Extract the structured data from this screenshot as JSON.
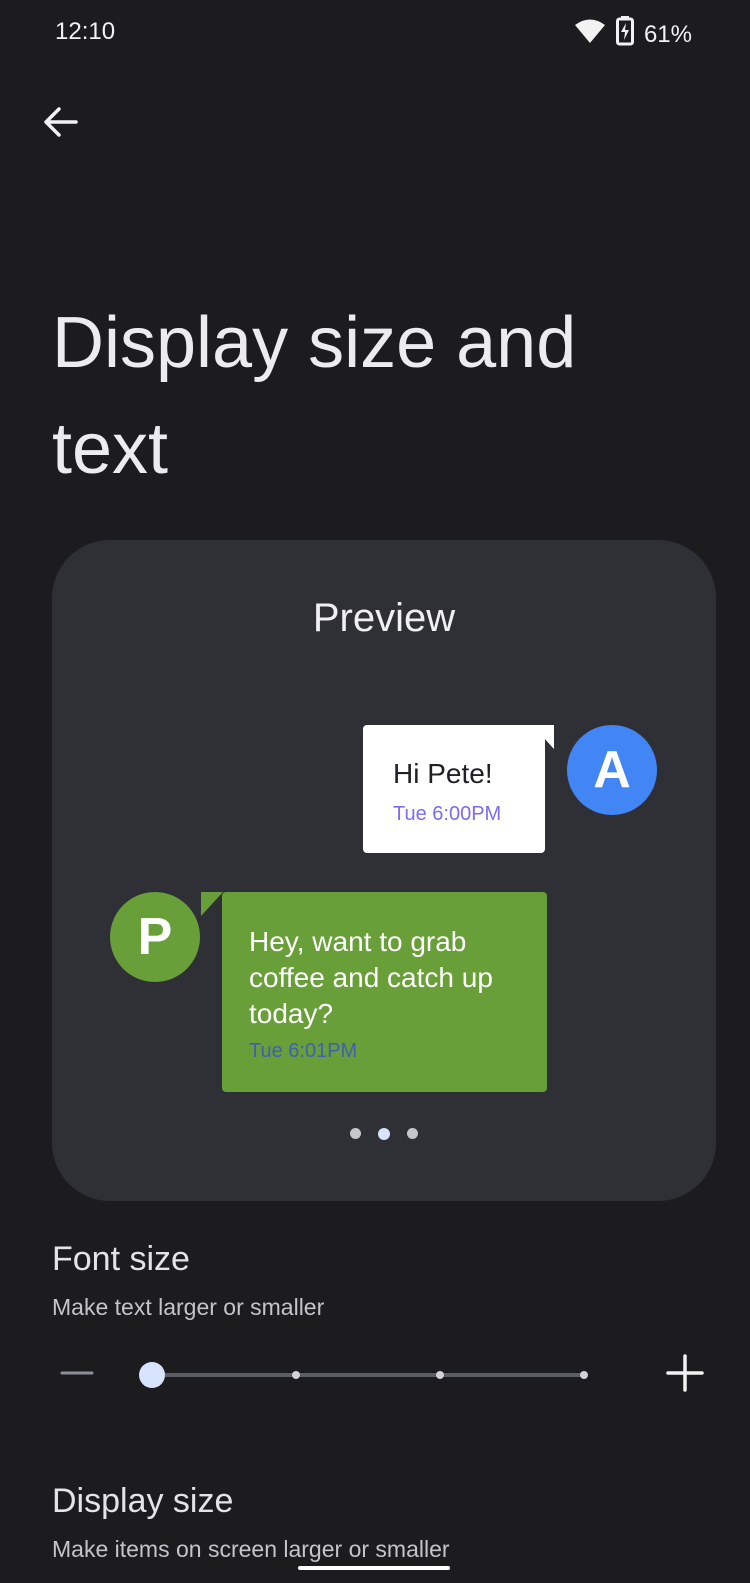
{
  "status_bar": {
    "time": "12:10",
    "battery": "61%",
    "icons": [
      "wifi-icon",
      "battery-charging-icon"
    ]
  },
  "header": {
    "back_icon": "arrow-back-icon"
  },
  "title": "Display size and text",
  "preview": {
    "title": "Preview",
    "outgoing": {
      "avatar_letter": "A",
      "message": "Hi Pete!",
      "time": "Tue 6:00PM",
      "avatar_color": "#4285f4"
    },
    "incoming": {
      "avatar_letter": "P",
      "message": "Hey, want to grab coffee and catch up today?",
      "time": "Tue 6:01PM",
      "bubble_color": "#689f38"
    },
    "pages": 3,
    "current_page": 2
  },
  "font_size": {
    "title": "Font size",
    "subtitle": "Make text larger or smaller",
    "steps": 4,
    "current_step": 1,
    "decrease_icon": "minus-icon",
    "increase_icon": "plus-icon"
  },
  "display_size": {
    "title": "Display size",
    "subtitle": "Make items on screen larger or smaller"
  },
  "colors": {
    "background": "#1c1c1f",
    "card": "#2f3035",
    "accent": "#d7e3ff"
  }
}
